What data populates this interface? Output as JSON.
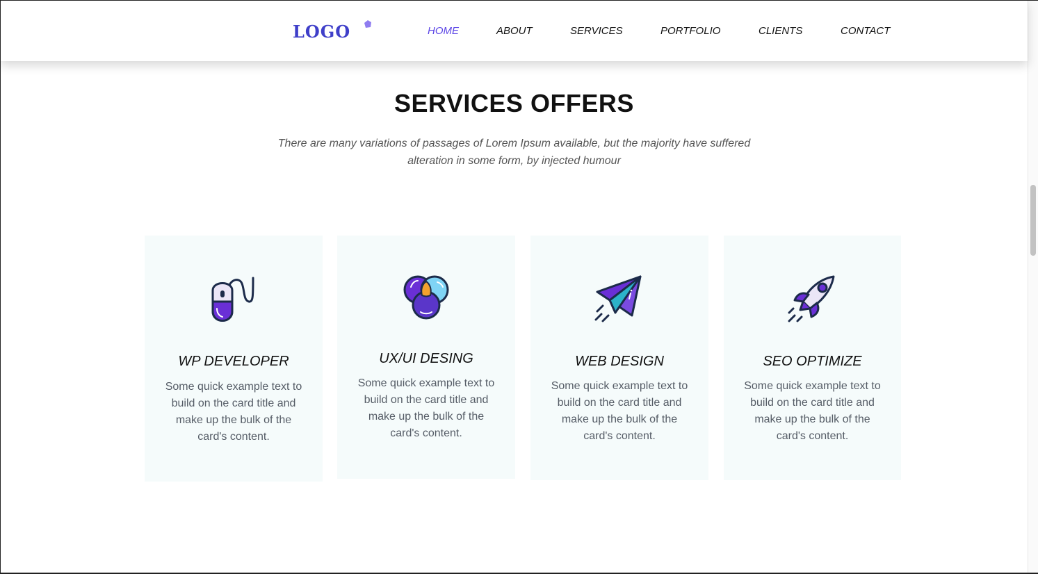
{
  "logo": {
    "text": "LOGO",
    "icon": "gem-icon"
  },
  "nav": {
    "items": [
      "HOME",
      "ABOUT",
      "SERVICES",
      "PORTFOLIO",
      "CLIENTS",
      "CONTACT"
    ],
    "active_index": 0
  },
  "section": {
    "title": "SERVICES OFFERS",
    "subtitle": "There are many variations of passages of Lorem Ipsum available, but the majority have suffered alteration in some form, by injected humour"
  },
  "cards": [
    {
      "title": "WP DEVELOPER",
      "icon": "mouse-icon",
      "text": "Some quick example text to build on the card title and make up the bulk of the card's content."
    },
    {
      "title": "UX/UI DESING",
      "icon": "color-circles-icon",
      "text": "Some quick example text to build on the card title and make up the bulk of the card's content."
    },
    {
      "title": "WEB DESIGN",
      "icon": "paper-plane-icon",
      "text": "Some quick example text to build on the card title and make up the bulk of the card's content."
    },
    {
      "title": "SEO OPTIMIZE",
      "icon": "rocket-icon",
      "text": "Some quick example text to build on the card title and make up the bulk of the card's content."
    }
  ],
  "colors": {
    "accent": "#5b45e6",
    "logo": "#3f3fc9",
    "icon_purple": "#6a2fd6",
    "icon_blue": "#7fd4f5",
    "icon_outline": "#1c2b4a",
    "card_bg": "#f5fbfb"
  }
}
